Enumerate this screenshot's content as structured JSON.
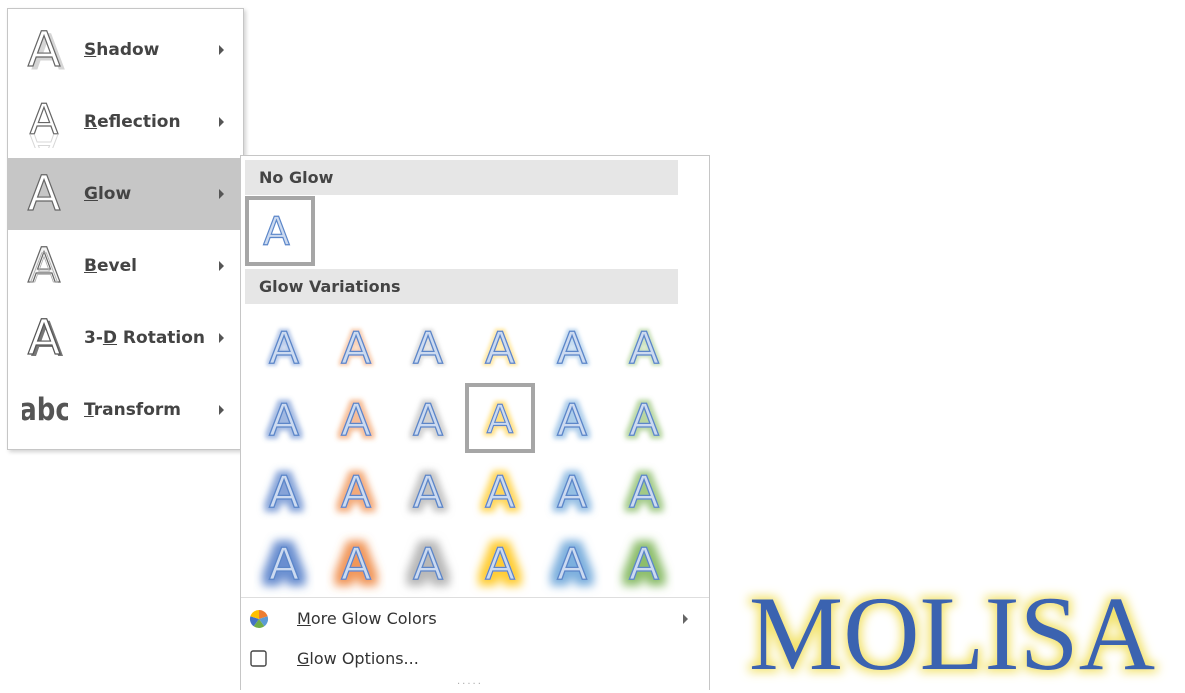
{
  "effects_menu": {
    "items": [
      {
        "accel": "S",
        "rest": "hadow",
        "pre": "",
        "icon": "shadow-a-icon"
      },
      {
        "accel": "R",
        "rest": "eflection",
        "pre": "",
        "icon": "reflection-a-icon"
      },
      {
        "accel": "G",
        "rest": "low",
        "pre": "",
        "icon": "glow-a-icon",
        "selected": true
      },
      {
        "accel": "B",
        "rest": "evel",
        "pre": "",
        "icon": "bevel-a-icon"
      },
      {
        "accel": "D",
        "rest": " Rotation",
        "pre": "3-",
        "icon": "rotation-3d-a-icon"
      },
      {
        "accel": "T",
        "rest": "ransform",
        "pre": "",
        "icon": "transform-abc-icon"
      }
    ]
  },
  "glow_panel": {
    "no_glow_header": "No Glow",
    "variations_header": "Glow Variations",
    "glow_colors": [
      "#4472c4",
      "#ed7d31",
      "#a5a5a5",
      "#ffc000",
      "#5b9bd5",
      "#70ad47"
    ],
    "selected_variation": {
      "row": 1,
      "col": 3
    },
    "more_colors": {
      "accel": "M",
      "rest": "ore Glow Colors"
    },
    "options": {
      "accel": "G",
      "rest": "low Options..."
    },
    "grip": "....."
  },
  "preview_text": "MOLISA",
  "colors": {
    "menu_selected": "#c6c6c6",
    "header_bg": "#e6e6e6",
    "letter_fill": "#ccdaf0",
    "letter_stroke": "#5b86c9",
    "preview_text": "#3a64b0",
    "preview_glow": "#f2e26a"
  }
}
